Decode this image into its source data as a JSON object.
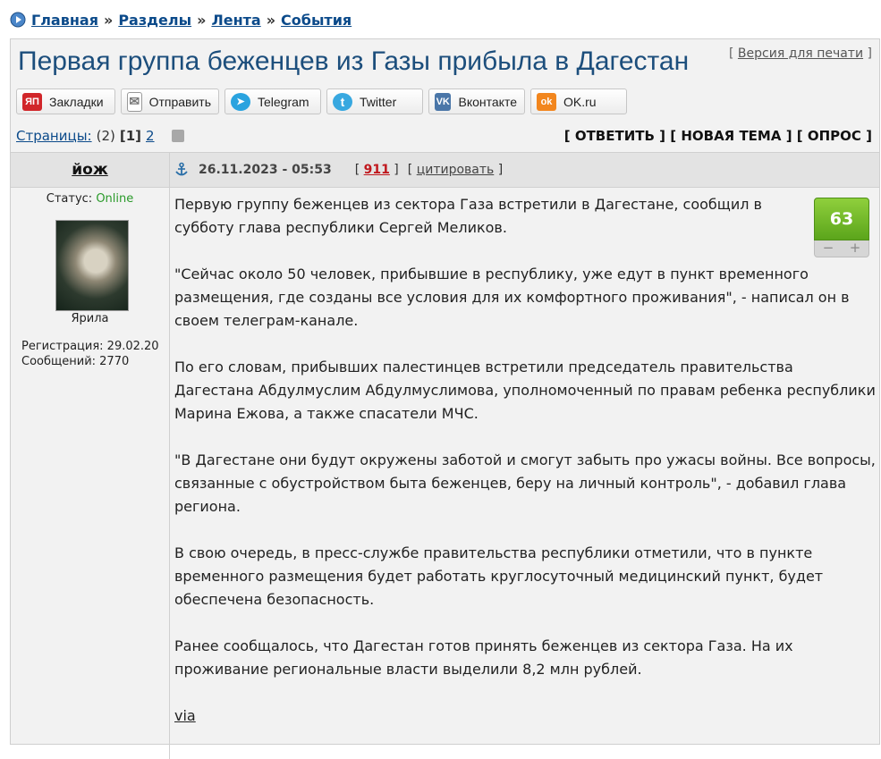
{
  "breadcrumb": {
    "items": [
      "Главная",
      "Разделы",
      "Лента",
      "События"
    ],
    "sep": "»"
  },
  "title": "Первая группа беженцев из Газы прибыла в Дагестан",
  "print": {
    "left": "[",
    "label": "Версия для печати",
    "right": "]"
  },
  "share": [
    {
      "label": "Закладки",
      "icon": "yandex-bookmarks-icon",
      "color": "#d1262a",
      "glyph": "ЯП"
    },
    {
      "label": "Отправить",
      "icon": "envelope-icon",
      "color": "#ffffff",
      "glyph": "✉"
    },
    {
      "label": "Telegram",
      "icon": "telegram-icon",
      "color": "#2aa3df",
      "glyph": "➤"
    },
    {
      "label": "Twitter",
      "icon": "twitter-icon",
      "color": "#38a8e0",
      "glyph": "t"
    },
    {
      "label": "Вконтакте",
      "icon": "vk-icon",
      "color": "#4a76a8",
      "glyph": "VK"
    },
    {
      "label": "OK.ru",
      "icon": "ok-icon",
      "color": "#f2861e",
      "glyph": "ok"
    }
  ],
  "pager": {
    "label": "Страницы:",
    "total": "(2)",
    "current": "[1]",
    "next": "2"
  },
  "actions": {
    "reply": "ОТВЕТИТЬ",
    "new_topic": "НОВАЯ ТЕМА",
    "poll": "ОПРОС"
  },
  "post": {
    "author": "йож",
    "status_label": "Статус:",
    "status_value": "Online",
    "avatar_caption": "Ярила",
    "reg_label": "Регистрация: 29.02.20",
    "msgs_label": "Сообщений: 2770",
    "date": "26.11.2023 - 05:53",
    "number": "911",
    "cite": "цитировать",
    "rating": "63",
    "paragraphs": [
      "Первую группу беженцев из сектора Газа встретили в Дагестане, сообщил в субботу глава республики Сергей Меликов.",
      "\"Сейчас около 50 человек, прибывшие в республику, уже едут в пункт временного размещения, где созданы все условия для их комфортного проживания\", - написал он в своем телеграм-канале.",
      "По его словам, прибывших палестинцев встретили председатель правительства Дагестана Абдулмуслим Абдулмуслимова, уполномоченный по правам ребенка республики Марина Ежова, а также спасатели МЧС.",
      "\"В Дагестане они будут окружены заботой и смогут забыть про ужасы войны. Все вопросы, связанные с обустройством быта беженцев, беру на личный контроль\", - добавил глава региона.",
      "В свою очередь, в пресс-службе правительства республики отметили, что в пункте временного размещения будет работать круглосуточный медицинский пункт, будет обеспечена безопасность.",
      "Ранее сообщалось, что Дагестан готов принять беженцев из сектора Газа. На их проживание региональные власти выделили 8,2 млн рублей."
    ],
    "via": "via"
  },
  "colors": {
    "title": "#1c4e7c",
    "link": "#0b4a8a",
    "online": "#2a9a2a",
    "rating": "#6bb524"
  }
}
